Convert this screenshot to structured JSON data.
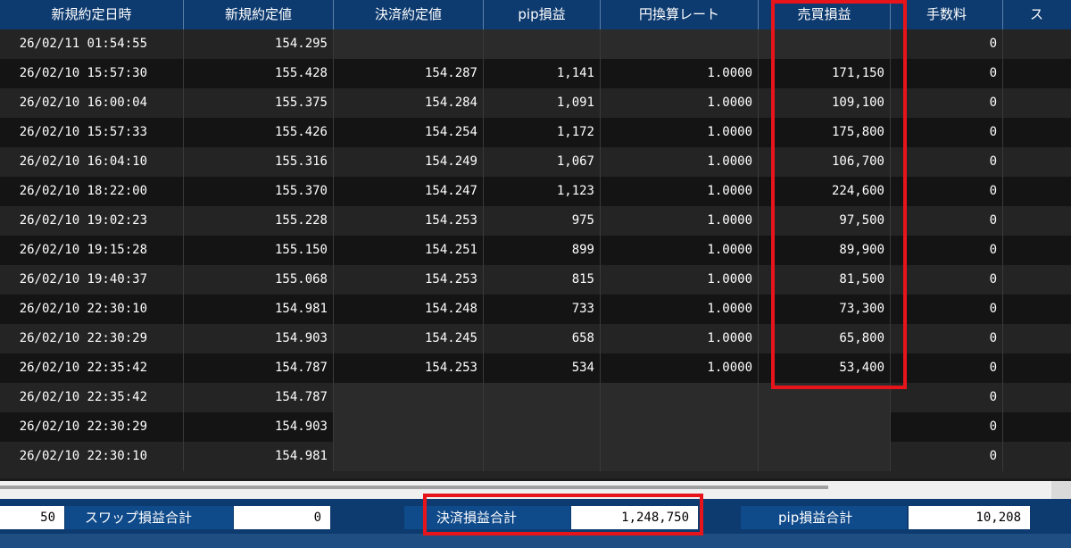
{
  "columns": {
    "open_datetime": "新規約定日時",
    "open_price": "新規約定値",
    "close_price": "決済約定値",
    "pip_pl": "pip損益",
    "jpy_rate": "円換算レート",
    "trade_pl": "売買損益",
    "fee": "手数料",
    "swap_partial": "ス"
  },
  "rows": [
    {
      "open_datetime": "26/02/11 01:54:55",
      "open_price": "154.295",
      "close_price": "",
      "pip_pl": "",
      "jpy_rate": "",
      "trade_pl": "",
      "fee": "0"
    },
    {
      "open_datetime": "26/02/10 15:57:30",
      "open_price": "155.428",
      "close_price": "154.287",
      "pip_pl": "1,141",
      "jpy_rate": "1.0000",
      "trade_pl": "171,150",
      "fee": "0"
    },
    {
      "open_datetime": "26/02/10 16:00:04",
      "open_price": "155.375",
      "close_price": "154.284",
      "pip_pl": "1,091",
      "jpy_rate": "1.0000",
      "trade_pl": "109,100",
      "fee": "0"
    },
    {
      "open_datetime": "26/02/10 15:57:33",
      "open_price": "155.426",
      "close_price": "154.254",
      "pip_pl": "1,172",
      "jpy_rate": "1.0000",
      "trade_pl": "175,800",
      "fee": "0"
    },
    {
      "open_datetime": "26/02/10 16:04:10",
      "open_price": "155.316",
      "close_price": "154.249",
      "pip_pl": "1,067",
      "jpy_rate": "1.0000",
      "trade_pl": "106,700",
      "fee": "0"
    },
    {
      "open_datetime": "26/02/10 18:22:00",
      "open_price": "155.370",
      "close_price": "154.247",
      "pip_pl": "1,123",
      "jpy_rate": "1.0000",
      "trade_pl": "224,600",
      "fee": "0"
    },
    {
      "open_datetime": "26/02/10 19:02:23",
      "open_price": "155.228",
      "close_price": "154.253",
      "pip_pl": "975",
      "jpy_rate": "1.0000",
      "trade_pl": "97,500",
      "fee": "0"
    },
    {
      "open_datetime": "26/02/10 19:15:28",
      "open_price": "155.150",
      "close_price": "154.251",
      "pip_pl": "899",
      "jpy_rate": "1.0000",
      "trade_pl": "89,900",
      "fee": "0"
    },
    {
      "open_datetime": "26/02/10 19:40:37",
      "open_price": "155.068",
      "close_price": "154.253",
      "pip_pl": "815",
      "jpy_rate": "1.0000",
      "trade_pl": "81,500",
      "fee": "0"
    },
    {
      "open_datetime": "26/02/10 22:30:10",
      "open_price": "154.981",
      "close_price": "154.248",
      "pip_pl": "733",
      "jpy_rate": "1.0000",
      "trade_pl": "73,300",
      "fee": "0"
    },
    {
      "open_datetime": "26/02/10 22:30:29",
      "open_price": "154.903",
      "close_price": "154.245",
      "pip_pl": "658",
      "jpy_rate": "1.0000",
      "trade_pl": "65,800",
      "fee": "0"
    },
    {
      "open_datetime": "26/02/10 22:35:42",
      "open_price": "154.787",
      "close_price": "154.253",
      "pip_pl": "534",
      "jpy_rate": "1.0000",
      "trade_pl": "53,400",
      "fee": "0"
    },
    {
      "open_datetime": "26/02/10 22:35:42",
      "open_price": "154.787",
      "close_price": "",
      "pip_pl": "",
      "jpy_rate": "",
      "trade_pl": "",
      "fee": "0"
    },
    {
      "open_datetime": "26/02/10 22:30:29",
      "open_price": "154.903",
      "close_price": "",
      "pip_pl": "",
      "jpy_rate": "",
      "trade_pl": "",
      "fee": "0"
    },
    {
      "open_datetime": "26/02/10 22:30:10",
      "open_price": "154.981",
      "close_price": "",
      "pip_pl": "",
      "jpy_rate": "",
      "trade_pl": "",
      "fee": "0"
    }
  ],
  "footer": {
    "first_value_partial": "50",
    "swap_total_label": "スワップ損益合計",
    "swap_total_value": "0",
    "settled_total_label": "決済損益合計",
    "settled_total_value": "1,248,750",
    "pip_total_label": "pip損益合計",
    "pip_total_value": "10,208"
  },
  "colors": {
    "header_bg": "#0d3a6f",
    "highlight": "#e8141c",
    "row_odd": "#242424",
    "row_even": "#141414"
  }
}
